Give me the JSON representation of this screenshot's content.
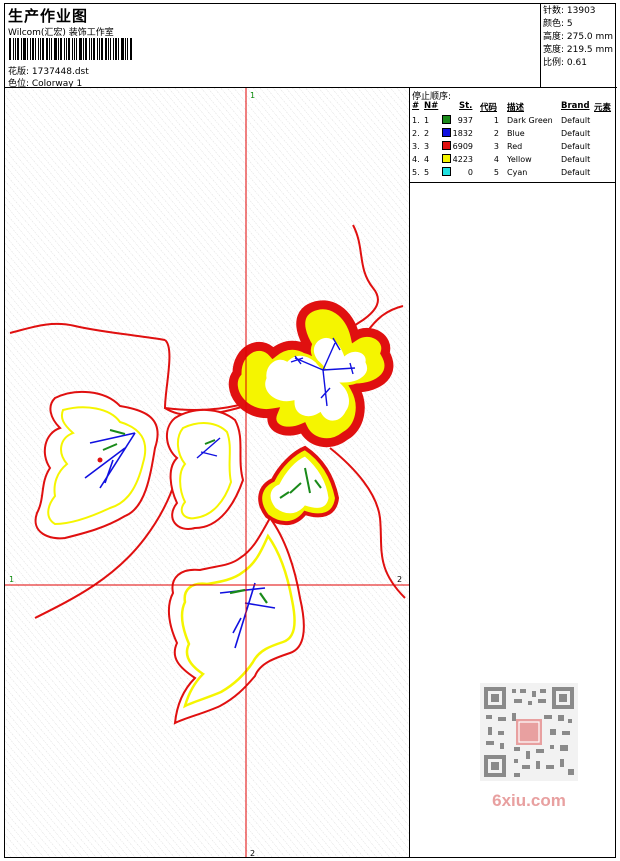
{
  "header": {
    "title": "生产作业图",
    "company": "Wilcom(汇宏) 装饰工作室",
    "design_label": "花版: 1737448.dst",
    "colorway_label": "色位: Colorway 1"
  },
  "stats": {
    "stitches": "针数: 13903",
    "colors": "颜色: 5",
    "height": "高度: 275.0 mm",
    "width": "宽度: 219.5 mm",
    "ratio": "比例: 0.61"
  },
  "stop_sequence": {
    "title": "停止顺序:",
    "columns": [
      "#",
      "N#",
      "St.",
      "代码",
      "描述",
      "Brand",
      "元素"
    ],
    "rows": [
      {
        "idx": "1.",
        "n": "1",
        "color": "#1a8a1a",
        "st": "937",
        "code": "1",
        "desc": "Dark Green",
        "brand": "Default"
      },
      {
        "idx": "2.",
        "n": "2",
        "color": "#1010e0",
        "st": "1832",
        "code": "2",
        "desc": "Blue",
        "brand": "Default"
      },
      {
        "idx": "3.",
        "n": "3",
        "color": "#e01010",
        "st": "6909",
        "code": "3",
        "desc": "Red",
        "brand": "Default"
      },
      {
        "idx": "4.",
        "n": "4",
        "color": "#f5f500",
        "st": "4223",
        "code": "4",
        "desc": "Yellow",
        "brand": "Default"
      },
      {
        "idx": "5.",
        "n": "5",
        "color": "#20e0e0",
        "st": "0",
        "code": "5",
        "desc": "Cyan",
        "brand": "Default"
      }
    ]
  },
  "crosshair": {
    "top_label": "1",
    "bottom_label": "2",
    "left_label": "1",
    "right_label": "2"
  },
  "watermark": {
    "text": "6xiu.com"
  },
  "colors": {
    "red": "#e01010",
    "yellow": "#f5f500",
    "blue": "#1010e0",
    "green": "#1a8a1a",
    "crosshair": "#e00000"
  }
}
